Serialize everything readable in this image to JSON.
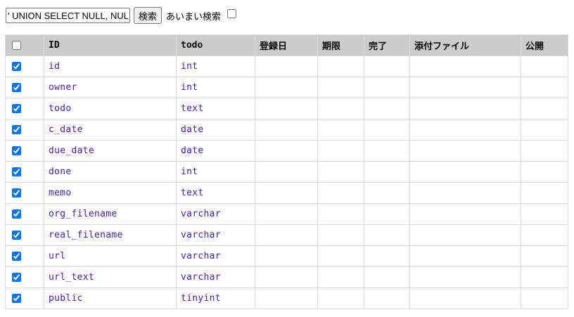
{
  "search": {
    "value": "' UNION SELECT NULL, NULL",
    "button_label": "検索",
    "fuzzy_label": "あいまい検索",
    "fuzzy_checked": false
  },
  "table": {
    "columns": [
      "",
      "ID",
      "todo",
      "登録日",
      "期限",
      "完了",
      "添付ファイル",
      "公開"
    ],
    "select_all_checked": false,
    "rows": [
      {
        "checked": true,
        "id": "id",
        "todo": "int"
      },
      {
        "checked": true,
        "id": "owner",
        "todo": "int"
      },
      {
        "checked": true,
        "id": "todo",
        "todo": "text"
      },
      {
        "checked": true,
        "id": "c_date",
        "todo": "date"
      },
      {
        "checked": true,
        "id": "due_date",
        "todo": "date"
      },
      {
        "checked": true,
        "id": "done",
        "todo": "int"
      },
      {
        "checked": true,
        "id": "memo",
        "todo": "text"
      },
      {
        "checked": true,
        "id": "org_filename",
        "todo": "varchar"
      },
      {
        "checked": true,
        "id": "real_filename",
        "todo": "varchar"
      },
      {
        "checked": true,
        "id": "url",
        "todo": "varchar"
      },
      {
        "checked": true,
        "id": "url_text",
        "todo": "varchar"
      },
      {
        "checked": true,
        "id": "public",
        "todo": "tinyint"
      }
    ]
  },
  "colors": {
    "header_bg": "#cccccc",
    "cell_text": "#4b1bb0",
    "checkbox_accent": "#0075ff",
    "border": "#dddddd"
  }
}
